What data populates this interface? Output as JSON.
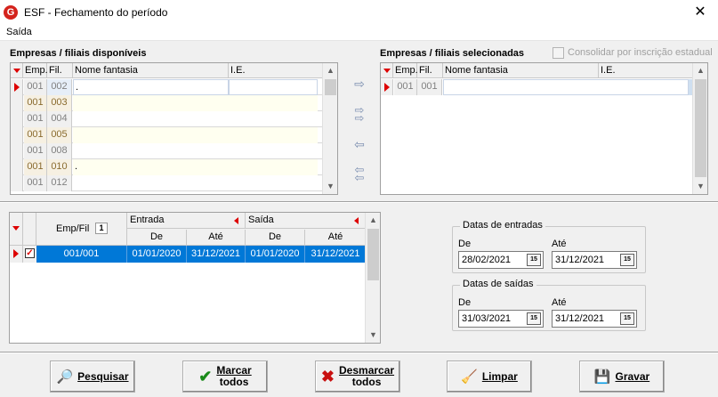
{
  "window": {
    "title": "ESF - Fechamento do período",
    "close_glyph": "✕",
    "app_icon_glyph": "G"
  },
  "menu": {
    "items": [
      {
        "label": "Saída"
      }
    ]
  },
  "available": {
    "title": "Empresas / filiais disponíveis",
    "columns": [
      "Emp.",
      "Fil.",
      "Nome fantasia",
      "I.E."
    ],
    "rows": [
      {
        "emp": "001",
        "fil": "002",
        "nome": ".",
        "ie": ""
      },
      {
        "emp": "001",
        "fil": "003",
        "nome": "",
        "ie": ""
      },
      {
        "emp": "001",
        "fil": "004",
        "nome": "",
        "ie": ""
      },
      {
        "emp": "001",
        "fil": "005",
        "nome": "",
        "ie": ""
      },
      {
        "emp": "001",
        "fil": "008",
        "nome": "",
        "ie": ""
      },
      {
        "emp": "001",
        "fil": "010",
        "nome": ".",
        "ie": ""
      },
      {
        "emp": "001",
        "fil": "012",
        "nome": "",
        "ie": ""
      }
    ]
  },
  "selected": {
    "title": "Empresas / filiais selecionadas",
    "consolidate_label": "Consolidar por inscrição estadual",
    "consolidate_checked": false,
    "columns": [
      "Emp.",
      "Fil.",
      "Nome fantasia",
      "I.E."
    ],
    "rows": [
      {
        "emp": "001",
        "fil": "001",
        "nome": "",
        "ie": ""
      }
    ]
  },
  "transfer": {
    "add_one": "⇨",
    "add_all": "⇨⇨",
    "remove_one": "⇦",
    "remove_all": "⇦⇦"
  },
  "periods": {
    "header_empfil": "Emp/Fil",
    "sort_badge": "1",
    "group_entrada": "Entrada",
    "group_saida": "Saída",
    "sub_de": "De",
    "sub_ate": "Até",
    "rows": [
      {
        "checked": true,
        "empfil": "001/001",
        "ent_de": "01/01/2020",
        "ent_ate": "31/12/2021",
        "sai_de": "01/01/2020",
        "sai_ate": "31/12/2021"
      }
    ]
  },
  "datas_entradas": {
    "title": "Datas de entradas",
    "de_label": "De",
    "ate_label": "Até",
    "de_value": "28/02/2021",
    "ate_value": "31/12/2021"
  },
  "datas_saidas": {
    "title": "Datas de saídas",
    "de_label": "De",
    "ate_label": "Até",
    "de_value": "31/03/2021",
    "ate_value": "31/12/2021"
  },
  "calendar_badge": "15",
  "buttons": {
    "pesquisar": "Pesquisar",
    "marcar_1": "Marcar",
    "marcar_2": "todos",
    "desmarcar_1": "Desmarcar",
    "desmarcar_2": "todos",
    "limpar": "Limpar",
    "gravar": "Gravar"
  },
  "icons": {
    "close": "close-icon",
    "search": "search-icon",
    "check": "check-icon",
    "cross": "cross-icon",
    "broom": "broom-icon",
    "save": "save-icon",
    "calendar": "calendar-icon"
  },
  "colors": {
    "selection": "#0078d7",
    "indicator": "#dd0000",
    "brand": "#d4231c"
  }
}
